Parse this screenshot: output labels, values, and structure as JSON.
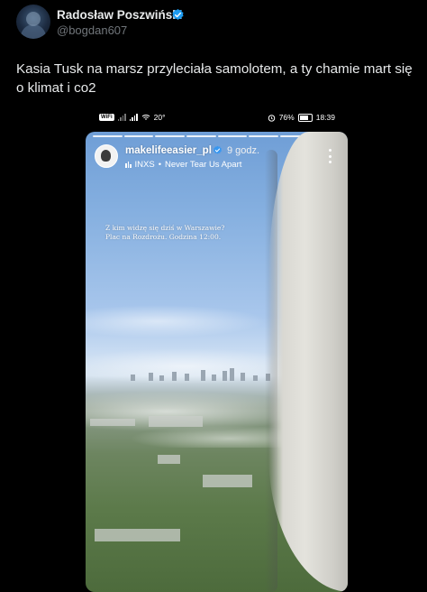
{
  "tweet": {
    "display_name": "Radosław Poszwiński",
    "handle": "@bogdan607",
    "text": "Kasia Tusk na marsz przyleciała samolotem, a ty chamie mart się o klimat i co2",
    "verified_color": "#1d9bf0"
  },
  "phone_status": {
    "network_badge": "WiFi",
    "wifi_label": "20°",
    "battery": "76%",
    "battery_level": 0.76,
    "time": "18:39"
  },
  "story": {
    "username": "makelifeeasier_pl",
    "time_ago": "9 godz.",
    "music_artist": "INXS",
    "music_separator": "•",
    "music_title": "Never Tear Us Apart",
    "caption_line1": "Z kim widzę się dziś w Warszawie?",
    "caption_line2": "Plac na Rozdrożu. Godzina 12:00.",
    "progress_segments": 8
  }
}
